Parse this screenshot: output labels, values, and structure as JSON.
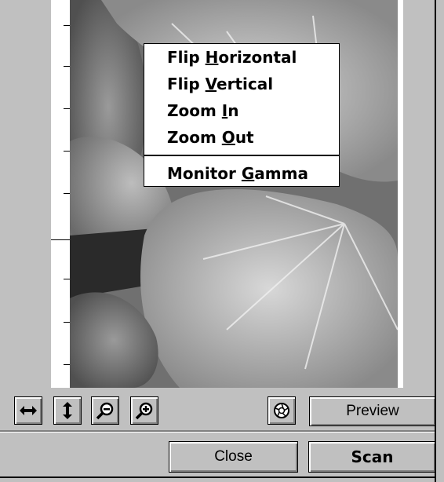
{
  "context_menu": {
    "items": [
      {
        "before": "Flip ",
        "accel": "H",
        "after": "orizontal"
      },
      {
        "before": "Flip ",
        "accel": "V",
        "after": "ertical"
      },
      {
        "before": "Zoom ",
        "accel": "I",
        "after": "n"
      },
      {
        "before": "Zoom ",
        "accel": "O",
        "after": "ut"
      },
      {
        "before": "Monitor ",
        "accel": "G",
        "after": "amma"
      }
    ]
  },
  "toolbar": {
    "flip_horizontal_icon": "double-arrow-horizontal-icon",
    "flip_vertical_icon": "double-arrow-vertical-icon",
    "zoom_out_icon": "magnifier-minus-icon",
    "zoom_in_icon": "magnifier-plus-icon",
    "aperture_icon": "aperture-icon",
    "preview_label": "Preview"
  },
  "actions": {
    "close_label": "Close",
    "scan_label": "Scan"
  },
  "colors": {
    "window_bg": "#c0c0c0",
    "menu_bg": "#ffffff",
    "text": "#000000"
  }
}
